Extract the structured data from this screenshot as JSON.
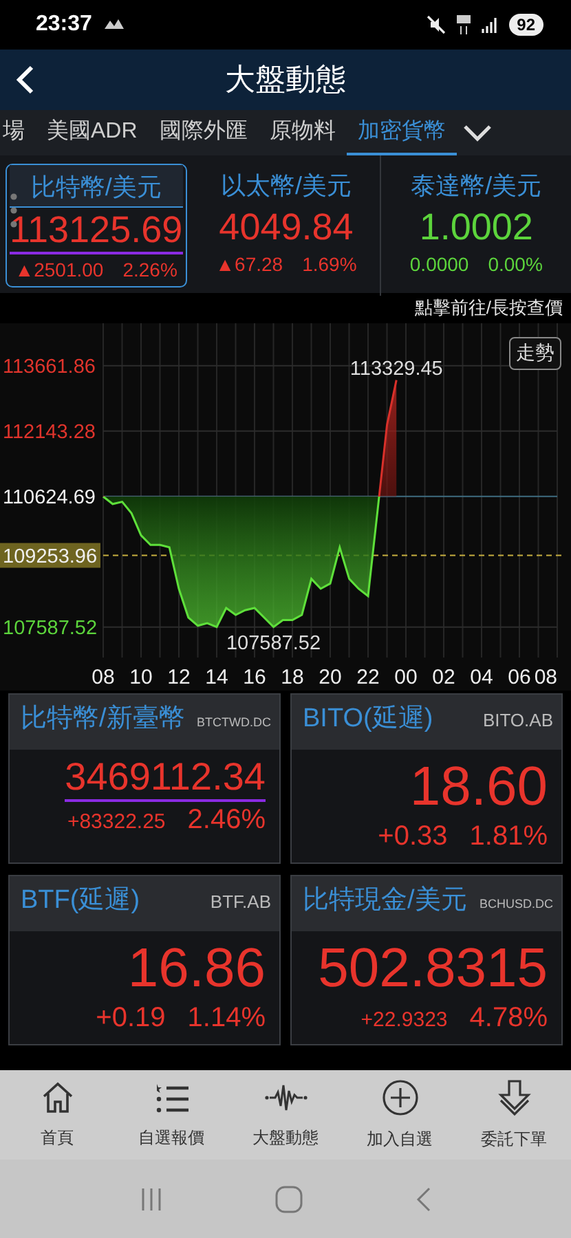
{
  "status_bar": {
    "time": "23:37",
    "battery": "92"
  },
  "header": {
    "title": "大盤動態"
  },
  "tabs": [
    {
      "label": "場",
      "selected": false
    },
    {
      "label": "美國ADR",
      "selected": false
    },
    {
      "label": "國際外匯",
      "selected": false
    },
    {
      "label": "原物料",
      "selected": false
    },
    {
      "label": "加密貨幣",
      "selected": true
    }
  ],
  "tickers": [
    {
      "name": "比特幣/美元",
      "price": "113125.69",
      "arrow": "▲",
      "change": "2501.00",
      "percent": "2.26%",
      "color": "#e8342c",
      "selected": true,
      "underlined": true
    },
    {
      "name": "以太幣/美元",
      "price": "4049.84",
      "arrow": "▲",
      "change": "67.28",
      "percent": "1.69%",
      "color": "#e8342c",
      "selected": false,
      "underlined": false
    },
    {
      "name": "泰達幣/美元",
      "price": "1.0002",
      "change": "0.0000",
      "percent": "0.00%",
      "color": "#5cd43c",
      "selected": false,
      "underlined": false
    }
  ],
  "hint": "點擊前往/長按查價",
  "chart": {
    "button": "走勢",
    "chart_data": {
      "type": "area",
      "grid": true,
      "x": [
        8,
        8.5,
        9,
        9.5,
        10,
        10.5,
        11,
        11.5,
        12,
        12.5,
        13,
        13.5,
        14,
        14.5,
        15,
        15.5,
        16,
        16.5,
        17,
        17.5,
        18,
        18.5,
        19,
        19.5,
        20,
        20.5,
        21,
        21.5,
        22,
        22.5,
        23,
        23.5
      ],
      "series": [
        {
          "color": "#5ee03a",
          "values": [
            110620,
            110450,
            110500,
            110230,
            109720,
            109500,
            109500,
            109440,
            108480,
            107810,
            107620,
            107680,
            107590,
            108030,
            107870,
            107980,
            108030,
            107810,
            107590,
            107750,
            107750,
            107870,
            108710,
            108480,
            108600,
            109440,
            108710,
            108480,
            108310,
            110290,
            112290,
            113330
          ]
        }
      ],
      "xlim": [
        8,
        32
      ],
      "ylim": [
        106880,
        114650
      ],
      "xticks": [
        {
          "value": 8,
          "label": "08"
        },
        {
          "value": 10,
          "label": "10"
        },
        {
          "value": 12,
          "label": "12"
        },
        {
          "value": 14,
          "label": "14"
        },
        {
          "value": 16,
          "label": "16"
        },
        {
          "value": 18,
          "label": "18"
        },
        {
          "value": 20,
          "label": "20"
        },
        {
          "value": 22,
          "label": "22"
        },
        {
          "value": 24,
          "label": "00"
        },
        {
          "value": 26,
          "label": "02"
        },
        {
          "value": 28,
          "label": "04"
        },
        {
          "value": 30,
          "label": "06"
        },
        {
          "value": 32,
          "label": "08"
        }
      ],
      "yticks": [
        {
          "value": 113661.86,
          "label": "113661.86"
        },
        {
          "value": 112143.28,
          "label": "112143.28"
        },
        {
          "value": 107587.52,
          "label": "107587.52"
        }
      ],
      "ref_lines": [
        {
          "axis": "y",
          "value": 110624.69,
          "label": "110624.69"
        },
        {
          "axis": "y",
          "value": 109253.96,
          "label": "109253.96"
        }
      ],
      "annotations": [
        {
          "x": 23.5,
          "y": 113329.45,
          "text": "113329.45"
        },
        {
          "x": 17,
          "y": 107587.52,
          "text": "107587.52"
        }
      ]
    }
  },
  "cards": [
    {
      "name": "比特幣/新臺幣",
      "code": "BTCTWD.DC",
      "price": "3469112.34",
      "change": "+83322.25",
      "percent": "2.46%",
      "underlined": true
    },
    {
      "name": "BITO(延遲)",
      "code": "BITO.AB",
      "price": "18.60",
      "change": "+0.33",
      "percent": "1.81%",
      "underlined": false
    },
    {
      "name": "BTF(延遲)",
      "code": "BTF.AB",
      "price": "16.86",
      "change": "+0.19",
      "percent": "1.14%",
      "underlined": false
    },
    {
      "name": "比特現金/美元",
      "code": "BCHUSD.DC",
      "price": "502.8315",
      "change": "+22.9323",
      "percent": "4.78%",
      "underlined": false
    }
  ],
  "bottom_nav": [
    {
      "kind": "home",
      "label": "首頁"
    },
    {
      "kind": "watchlist",
      "label": "自選報價"
    },
    {
      "kind": "market",
      "label": "大盤動態"
    },
    {
      "kind": "add",
      "label": "加入自選"
    },
    {
      "kind": "order",
      "label": "委託下單"
    }
  ]
}
